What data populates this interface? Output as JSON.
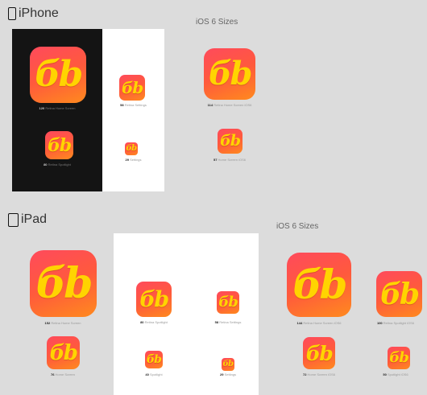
{
  "iphone": {
    "title": "iPhone",
    "ios6_label": "iOS 6 Sizes",
    "icons": [
      {
        "num": "120",
        "label": "Retina Home Screen"
      },
      {
        "num": "58",
        "label": "Retina Settings"
      },
      {
        "num": "80",
        "label": "Retina Spotlight"
      },
      {
        "num": "29",
        "label": "Settings"
      },
      {
        "num": "114",
        "label": "Retina Home Screen iOS6"
      },
      {
        "num": "57",
        "label": "Home Screen iOS6"
      }
    ]
  },
  "ipad": {
    "title": "iPad",
    "ios6_label": "iOS 6 Sizes",
    "icons": [
      {
        "num": "152",
        "label": "Retina Home Screen"
      },
      {
        "num": "76",
        "label": "Home Screen"
      },
      {
        "num": "80",
        "label": "Retina Spotlight"
      },
      {
        "num": "40",
        "label": "Spotlight"
      },
      {
        "num": "58",
        "label": "Retina Settings"
      },
      {
        "num": "29",
        "label": "Settings"
      },
      {
        "num": "144",
        "label": "Retina Home Screen iOS6"
      },
      {
        "num": "72",
        "label": "Home Screen iOS6"
      },
      {
        "num": "100",
        "label": "Retina Spotlight iOS6"
      },
      {
        "num": "50",
        "label": "Spotlight iOS6"
      }
    ]
  },
  "icon_glyph": "бb",
  "colors": {
    "gradient_top": "#ff4a5c",
    "gradient_bottom": "#ff8a1e",
    "glyph": "#ffd400",
    "dark_panel": "#141414",
    "light_panel": "#ffffff"
  }
}
